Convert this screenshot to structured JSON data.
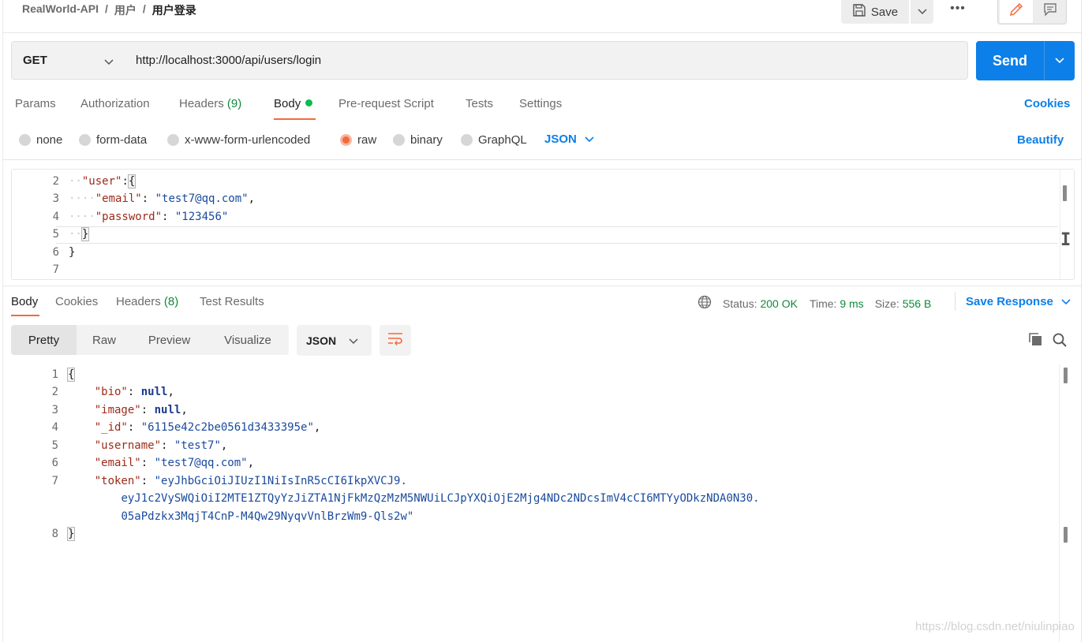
{
  "breadcrumb": {
    "collection": "RealWorld-API",
    "folder": "用户",
    "request": "用户登录",
    "sep": "/"
  },
  "header": {
    "save_label": "Save",
    "more_label": "•••"
  },
  "request": {
    "method": "GET",
    "url": "http://localhost:3000/api/users/login",
    "send_label": "Send",
    "tabs": [
      {
        "label": "Params"
      },
      {
        "label": "Authorization"
      },
      {
        "label": "Headers",
        "count": "(9)"
      },
      {
        "label": "Body"
      },
      {
        "label": "Pre-request Script"
      },
      {
        "label": "Tests"
      },
      {
        "label": "Settings"
      }
    ],
    "cookies_label": "Cookies",
    "body_types": [
      "none",
      "form-data",
      "x-www-form-urlencoded",
      "raw",
      "binary",
      "GraphQL"
    ],
    "selected_body_type": "raw",
    "format": "JSON",
    "beautify_label": "Beautify",
    "editor_lines": {
      "l2": {
        "num": "2",
        "key": "\"user\"",
        "colon": ":",
        "brace": "{"
      },
      "l3": {
        "num": "3",
        "key": "\"email\"",
        "colon": ": ",
        "value": "\"test7@qq.com\"",
        "comma": ","
      },
      "l4": {
        "num": "4",
        "key": "\"password\"",
        "colon": ": ",
        "value": "\"123456\""
      },
      "l5": {
        "num": "5",
        "brace": "}"
      },
      "l6": {
        "num": "6",
        "brace": "}"
      },
      "l7": {
        "num": "7"
      }
    }
  },
  "response": {
    "tabs": [
      {
        "label": "Body"
      },
      {
        "label": "Cookies"
      },
      {
        "label": "Headers",
        "count": "(8)"
      },
      {
        "label": "Test Results"
      }
    ],
    "status_label": "Status:",
    "status_value": "200 OK",
    "time_label": "Time:",
    "time_value": "9 ms",
    "size_label": "Size:",
    "size_value": "556 B",
    "save_response_label": "Save Response",
    "views": [
      "Pretty",
      "Raw",
      "Preview",
      "Visualize"
    ],
    "format": "JSON",
    "lines": {
      "l1": {
        "num": "1",
        "brace": "{"
      },
      "l2": {
        "num": "2",
        "key": "\"bio\"",
        "value": "null"
      },
      "l3": {
        "num": "3",
        "key": "\"image\"",
        "value": "null"
      },
      "l4": {
        "num": "4",
        "key": "\"_id\"",
        "value": "\"6115e42c2be0561d3433395e\""
      },
      "l5": {
        "num": "5",
        "key": "\"username\"",
        "value": "\"test7\""
      },
      "l6": {
        "num": "6",
        "key": "\"email\"",
        "value": "\"test7@qq.com\""
      },
      "l7": {
        "num": "7",
        "key": "\"token\"",
        "value_a": "\"eyJhbGciOiJIUzI1NiIsInR5cCI6IkpXVCJ9.",
        "value_b": "eyJ1c2VySWQiOiI2MTE1ZTQyYzJiZTA1NjFkMzQzMzM5NWUiLCJpYXQiOjE2Mjg4NDc2NDcsImV4cCI6MTYyODkzNDA0N30.",
        "value_c": "05aPdzkx3MqjT4CnP-M4Qw29NyqvVnlBrzWm9-Qls2w\""
      },
      "l8": {
        "num": "8",
        "brace": "}"
      }
    }
  },
  "watermark": "https://blog.csdn.net/niulinpiao",
  "colors": {
    "accent_orange": "#f26b3a",
    "send_blue": "#0d7fe8",
    "success_green": "#0e8a3a"
  }
}
